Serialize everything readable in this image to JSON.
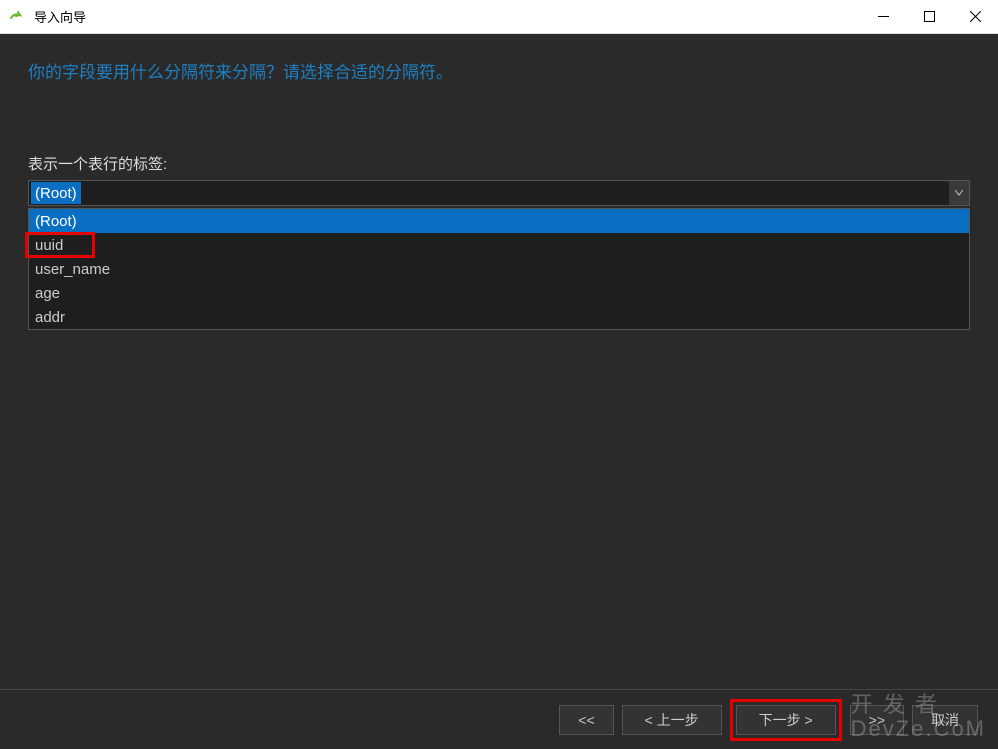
{
  "titlebar": {
    "title": "导入向导"
  },
  "instruction": "你的字段要用什么分隔符来分隔？请选择合适的分隔符。",
  "row_tag": {
    "label": "表示一个表行的标签:",
    "selected": "(Root)",
    "options": [
      "(Root)",
      "uuid",
      "user_name",
      "age",
      "addr"
    ]
  },
  "footer": {
    "first": "<<",
    "prev": "< 上一步",
    "next": "下一步 >",
    "last": ">>",
    "cancel": "取消"
  },
  "watermark": {
    "line1": "开 发 者",
    "line2": "DevZe.CoM"
  }
}
